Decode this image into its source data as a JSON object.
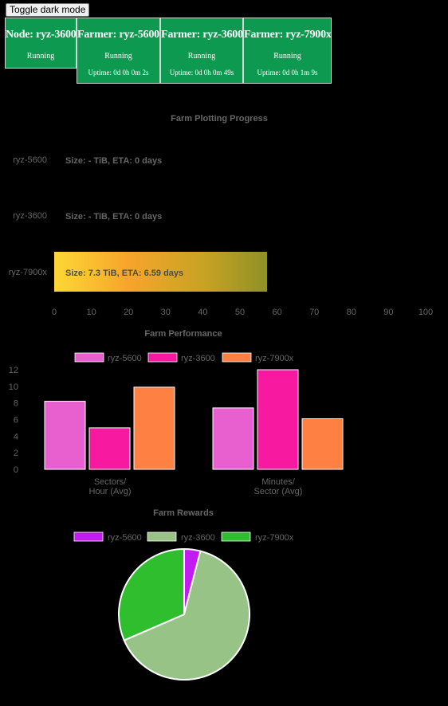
{
  "toggle_label": "Toggle dark mode",
  "cards": [
    {
      "title": "Node: ryz-3600",
      "status": "Running",
      "uptime": ""
    },
    {
      "title": "Farmer: ryz-5600",
      "status": "Running",
      "uptime": "Uptime: 0d 0h 0m 2s"
    },
    {
      "title": "Farmer: ryz-3600",
      "status": "Running",
      "uptime": "Uptime: 0d 0h 0m 49s"
    },
    {
      "title": "Farmer: ryz-7900x",
      "status": "Running",
      "uptime": "Uptime: 0d 0h 1m 9s"
    }
  ],
  "colors": {
    "card_bg": "#0d9950",
    "text_muted": "#666666",
    "ryz5600_perf": "#e860d0",
    "ryz3600_perf": "#f71aa0",
    "ryz7900x_perf": "#fe8143",
    "ryz5600_reward": "#c21cf2",
    "ryz3600_reward": "#98c387",
    "ryz7900x_reward": "#2fbf2e"
  },
  "chart_data": [
    {
      "type": "bar",
      "orientation": "horizontal",
      "title": "Farm Plotting Progress",
      "categories": [
        "ryz-5600",
        "ryz-3600",
        "ryz-7900x"
      ],
      "values": [
        0,
        0,
        57.3
      ],
      "bar_labels": [
        "Size: - TiB, ETA: 0 days",
        "Size: - TiB, ETA: 0 days",
        "Size: 7.3 TiB, ETA: 6.59 days"
      ],
      "xlim": [
        0,
        100
      ],
      "xticks": [
        "0",
        "10",
        "20",
        "30",
        "40",
        "50",
        "60",
        "70",
        "80",
        "90",
        "100"
      ]
    },
    {
      "type": "bar",
      "title": "Farm Performance",
      "categories": [
        "Sectors/\nHour (Avg)",
        "Minutes/\nSector (Avg)"
      ],
      "series": [
        {
          "name": "ryz-5600",
          "values": [
            8.2,
            7.4
          ]
        },
        {
          "name": "ryz-3600",
          "values": [
            5,
            12
          ]
        },
        {
          "name": "ryz-7900x",
          "values": [
            9.9,
            6.1
          ]
        }
      ],
      "ylim": [
        0,
        12
      ],
      "yticks": [
        "0",
        "2",
        "4",
        "6",
        "8",
        "10",
        "12"
      ],
      "legend": "top"
    },
    {
      "type": "pie",
      "title": "Farm Rewards",
      "labels": [
        "ryz-5600",
        "ryz-3600",
        "ryz-7900x"
      ],
      "values": [
        4,
        64.5,
        31.5
      ],
      "legend": "top"
    }
  ]
}
